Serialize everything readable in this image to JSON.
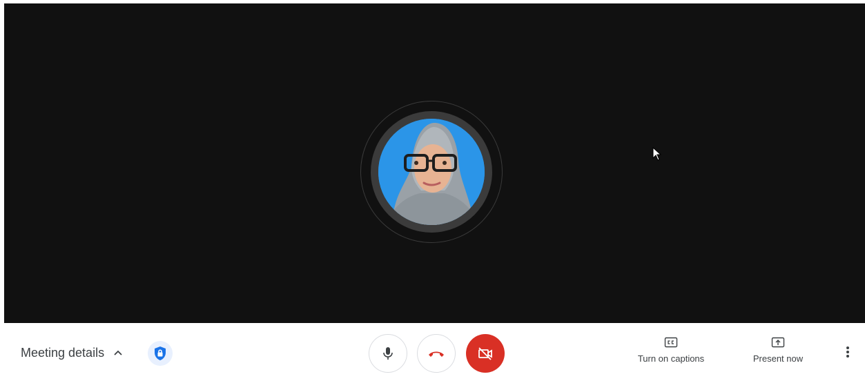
{
  "meeting": {
    "details_label": "Meeting details"
  },
  "controls": {
    "captions_label": "Turn on captions",
    "present_label": "Present now"
  },
  "icons": {
    "details_toggle": "chevron-up-icon",
    "security": "shield-lock-icon",
    "microphone": "microphone-icon",
    "hang_up": "phone-hangup-icon",
    "camera": "camera-off-icon",
    "captions": "closed-captions-icon",
    "present": "present-screen-icon",
    "more": "more-vertical-icon"
  },
  "colors": {
    "stage_background": "#111111",
    "camera_off_button": "#d93025",
    "hang_up_icon": "#d93025",
    "security_badge": "#1a73e8",
    "avatar_background": "#2b95e8"
  }
}
